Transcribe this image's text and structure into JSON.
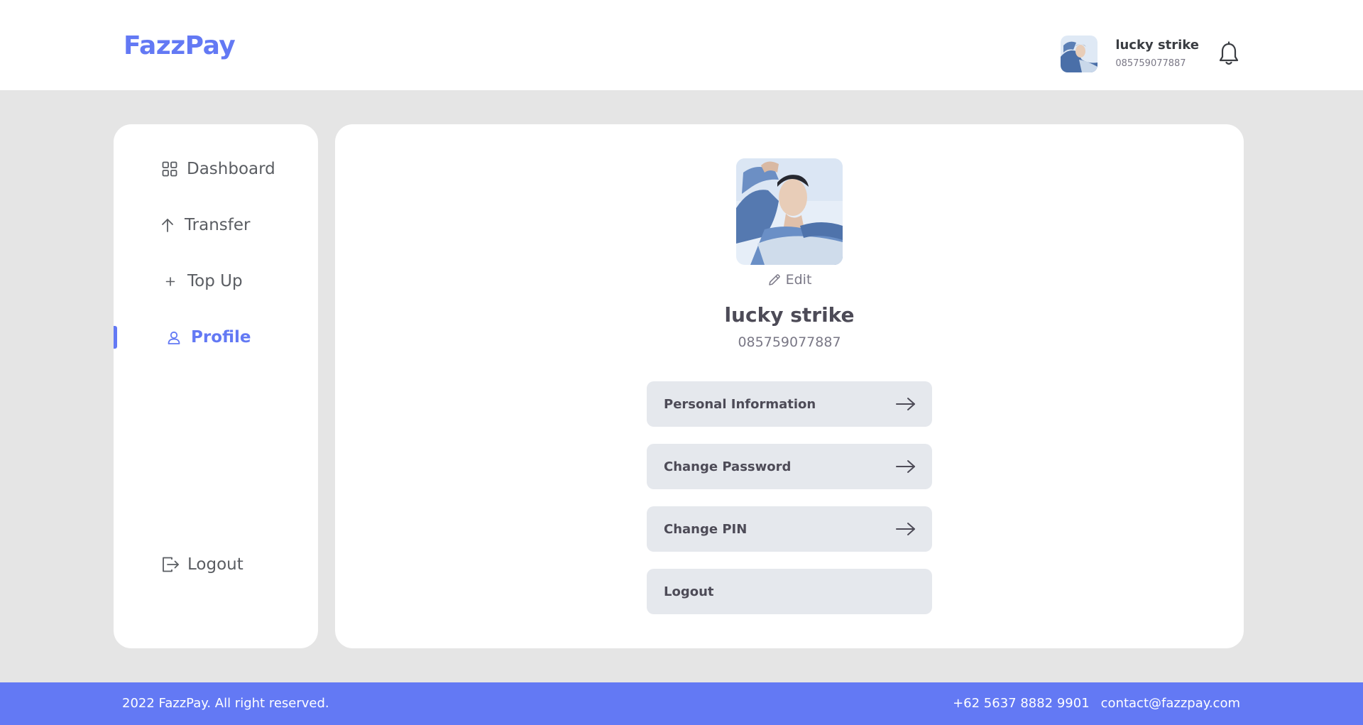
{
  "brand": {
    "name": "FazzPay",
    "color": "#6379f4"
  },
  "header": {
    "user_name": "lucky strike",
    "user_phone": "085759077887",
    "avatar_icon": "avatar",
    "notification_icon": "bell-icon"
  },
  "sidebar": {
    "items": [
      {
        "label": "Dashboard",
        "icon": "grid-icon",
        "active": false
      },
      {
        "label": "Transfer",
        "icon": "arrow-up-icon",
        "active": false
      },
      {
        "label": "Top Up",
        "icon": "plus-icon",
        "active": false
      },
      {
        "label": "Profile",
        "icon": "user-icon",
        "active": true
      }
    ],
    "logout": {
      "label": "Logout",
      "icon": "logout-icon"
    }
  },
  "profile": {
    "edit_label": "Edit",
    "name": "lucky strike",
    "phone": "085759077887",
    "menu": [
      {
        "label": "Personal Information",
        "icon": "arrow-right-icon"
      },
      {
        "label": "Change Password",
        "icon": "arrow-right-icon"
      },
      {
        "label": "Change PIN",
        "icon": "arrow-right-icon"
      },
      {
        "label": "Logout"
      }
    ]
  },
  "footer": {
    "copyright": "2022 FazzPay. All right reserved.",
    "phone": "+62 5637 8882 9901",
    "email": "contact@fazzpay.com"
  },
  "colors": {
    "accent": "#6379f4",
    "background": "#e5e5e5",
    "button_bg": "#e5e8ed"
  }
}
